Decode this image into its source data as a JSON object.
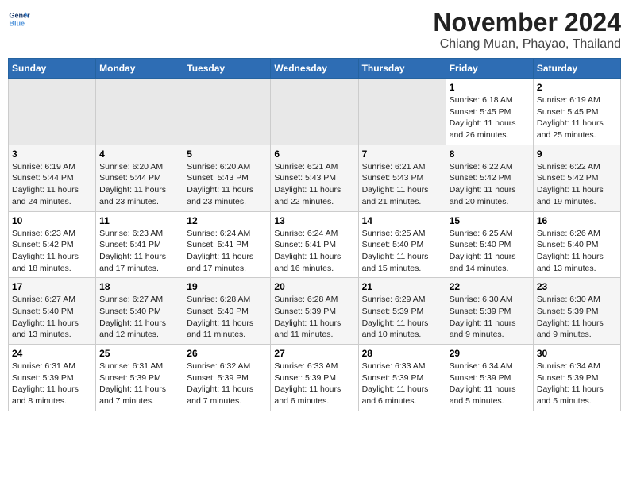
{
  "header": {
    "logo_line1": "General",
    "logo_line2": "Blue",
    "month": "November 2024",
    "location": "Chiang Muan, Phayao, Thailand"
  },
  "weekdays": [
    "Sunday",
    "Monday",
    "Tuesday",
    "Wednesday",
    "Thursday",
    "Friday",
    "Saturday"
  ],
  "weeks": [
    [
      {
        "day": "",
        "empty": true
      },
      {
        "day": "",
        "empty": true
      },
      {
        "day": "",
        "empty": true
      },
      {
        "day": "",
        "empty": true
      },
      {
        "day": "",
        "empty": true
      },
      {
        "day": "1",
        "sunrise": "6:18 AM",
        "sunset": "5:45 PM",
        "daylight": "11 hours and 26 minutes."
      },
      {
        "day": "2",
        "sunrise": "6:19 AM",
        "sunset": "5:45 PM",
        "daylight": "11 hours and 25 minutes."
      }
    ],
    [
      {
        "day": "3",
        "sunrise": "6:19 AM",
        "sunset": "5:44 PM",
        "daylight": "11 hours and 24 minutes."
      },
      {
        "day": "4",
        "sunrise": "6:20 AM",
        "sunset": "5:44 PM",
        "daylight": "11 hours and 23 minutes."
      },
      {
        "day": "5",
        "sunrise": "6:20 AM",
        "sunset": "5:43 PM",
        "daylight": "11 hours and 23 minutes."
      },
      {
        "day": "6",
        "sunrise": "6:21 AM",
        "sunset": "5:43 PM",
        "daylight": "11 hours and 22 minutes."
      },
      {
        "day": "7",
        "sunrise": "6:21 AM",
        "sunset": "5:43 PM",
        "daylight": "11 hours and 21 minutes."
      },
      {
        "day": "8",
        "sunrise": "6:22 AM",
        "sunset": "5:42 PM",
        "daylight": "11 hours and 20 minutes."
      },
      {
        "day": "9",
        "sunrise": "6:22 AM",
        "sunset": "5:42 PM",
        "daylight": "11 hours and 19 minutes."
      }
    ],
    [
      {
        "day": "10",
        "sunrise": "6:23 AM",
        "sunset": "5:42 PM",
        "daylight": "11 hours and 18 minutes."
      },
      {
        "day": "11",
        "sunrise": "6:23 AM",
        "sunset": "5:41 PM",
        "daylight": "11 hours and 17 minutes."
      },
      {
        "day": "12",
        "sunrise": "6:24 AM",
        "sunset": "5:41 PM",
        "daylight": "11 hours and 17 minutes."
      },
      {
        "day": "13",
        "sunrise": "6:24 AM",
        "sunset": "5:41 PM",
        "daylight": "11 hours and 16 minutes."
      },
      {
        "day": "14",
        "sunrise": "6:25 AM",
        "sunset": "5:40 PM",
        "daylight": "11 hours and 15 minutes."
      },
      {
        "day": "15",
        "sunrise": "6:25 AM",
        "sunset": "5:40 PM",
        "daylight": "11 hours and 14 minutes."
      },
      {
        "day": "16",
        "sunrise": "6:26 AM",
        "sunset": "5:40 PM",
        "daylight": "11 hours and 13 minutes."
      }
    ],
    [
      {
        "day": "17",
        "sunrise": "6:27 AM",
        "sunset": "5:40 PM",
        "daylight": "11 hours and 13 minutes."
      },
      {
        "day": "18",
        "sunrise": "6:27 AM",
        "sunset": "5:40 PM",
        "daylight": "11 hours and 12 minutes."
      },
      {
        "day": "19",
        "sunrise": "6:28 AM",
        "sunset": "5:40 PM",
        "daylight": "11 hours and 11 minutes."
      },
      {
        "day": "20",
        "sunrise": "6:28 AM",
        "sunset": "5:39 PM",
        "daylight": "11 hours and 11 minutes."
      },
      {
        "day": "21",
        "sunrise": "6:29 AM",
        "sunset": "5:39 PM",
        "daylight": "11 hours and 10 minutes."
      },
      {
        "day": "22",
        "sunrise": "6:30 AM",
        "sunset": "5:39 PM",
        "daylight": "11 hours and 9 minutes."
      },
      {
        "day": "23",
        "sunrise": "6:30 AM",
        "sunset": "5:39 PM",
        "daylight": "11 hours and 9 minutes."
      }
    ],
    [
      {
        "day": "24",
        "sunrise": "6:31 AM",
        "sunset": "5:39 PM",
        "daylight": "11 hours and 8 minutes."
      },
      {
        "day": "25",
        "sunrise": "6:31 AM",
        "sunset": "5:39 PM",
        "daylight": "11 hours and 7 minutes."
      },
      {
        "day": "26",
        "sunrise": "6:32 AM",
        "sunset": "5:39 PM",
        "daylight": "11 hours and 7 minutes."
      },
      {
        "day": "27",
        "sunrise": "6:33 AM",
        "sunset": "5:39 PM",
        "daylight": "11 hours and 6 minutes."
      },
      {
        "day": "28",
        "sunrise": "6:33 AM",
        "sunset": "5:39 PM",
        "daylight": "11 hours and 6 minutes."
      },
      {
        "day": "29",
        "sunrise": "6:34 AM",
        "sunset": "5:39 PM",
        "daylight": "11 hours and 5 minutes."
      },
      {
        "day": "30",
        "sunrise": "6:34 AM",
        "sunset": "5:39 PM",
        "daylight": "11 hours and 5 minutes."
      }
    ]
  ]
}
